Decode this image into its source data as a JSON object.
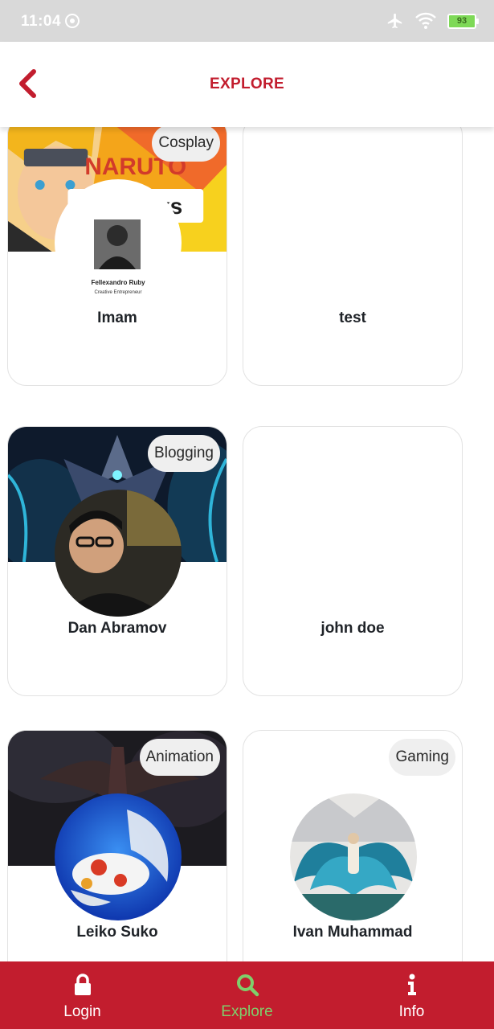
{
  "status_bar": {
    "time": "11:04",
    "battery": "93"
  },
  "header": {
    "title": "EXPLORE"
  },
  "cards": [
    {
      "name": "Imam",
      "category": "Cosplay",
      "cover_text": "NARUTO",
      "banner_brand": "ukaTalks",
      "avatar_caption_name": "Fellexandro Ruby",
      "avatar_caption_role": "Creative Entrepreneur"
    },
    {
      "name": "test",
      "category": ""
    },
    {
      "name": "Dan Abramov",
      "category": "Blogging"
    },
    {
      "name": "john doe",
      "category": ""
    },
    {
      "name": "Leiko Suko",
      "category": "Animation"
    },
    {
      "name": "Ivan Muhammad",
      "category": "Gaming"
    }
  ],
  "bottom_nav": [
    {
      "label": "Login",
      "icon": "lock-icon",
      "active": false
    },
    {
      "label": "Explore",
      "icon": "search-icon",
      "active": true
    },
    {
      "label": "Info",
      "icon": "info-icon",
      "active": false
    }
  ],
  "colors": {
    "brand": "#c21d2e",
    "active_nav": "#7fcf6b",
    "status_bar": "#d9d9d9"
  }
}
